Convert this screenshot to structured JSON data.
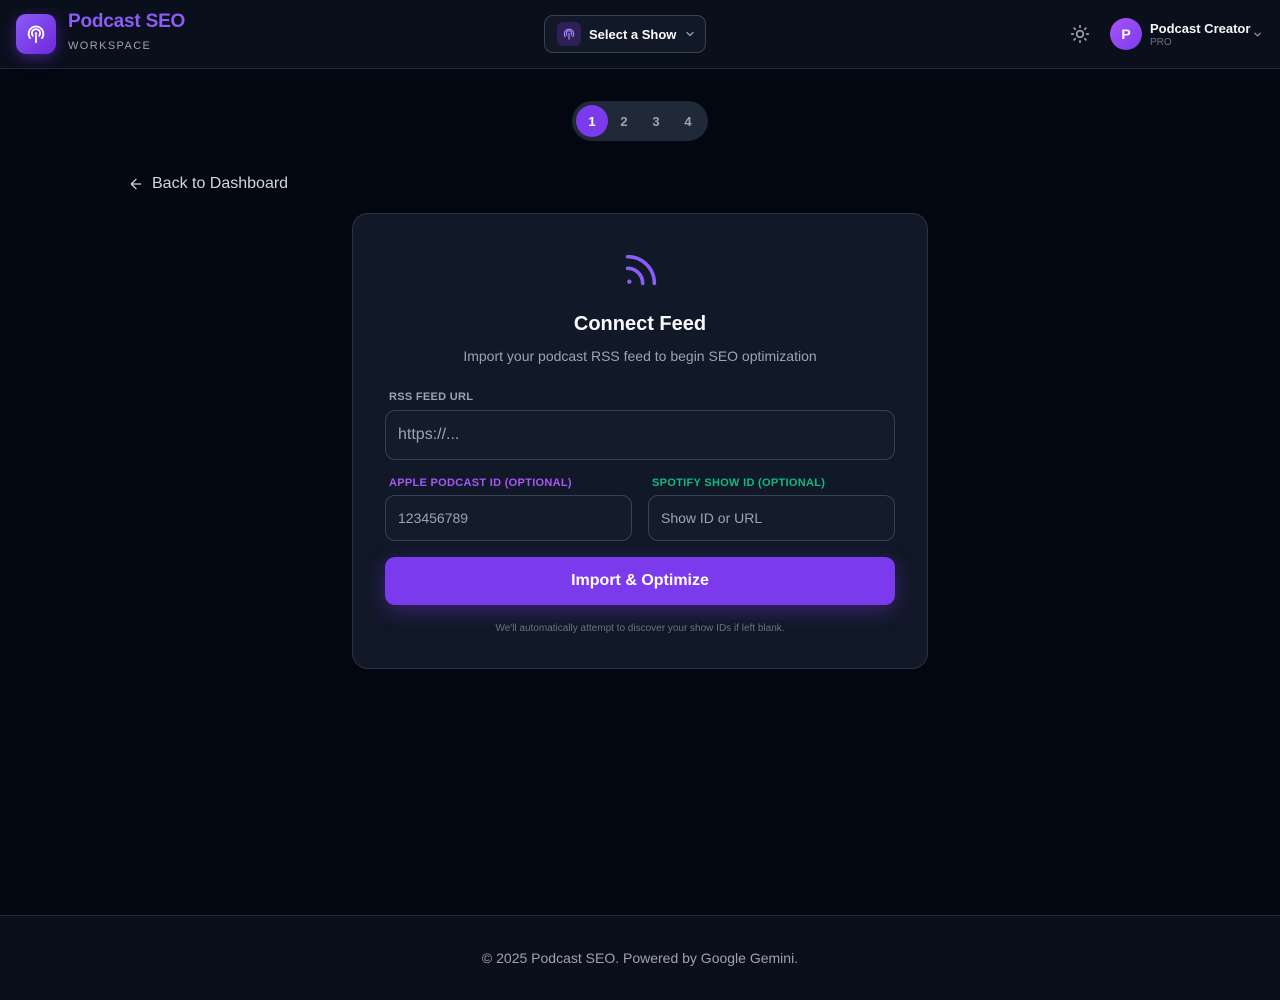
{
  "header": {
    "brand_title": "Podcast SEO",
    "brand_subtitle": "WORKSPACE",
    "show_selector_label": "Select a Show",
    "user": {
      "avatar_initial": "P",
      "name": "Podcast Creator",
      "plan": "PRO"
    }
  },
  "stepper": {
    "steps": [
      "1",
      "2",
      "3",
      "4"
    ],
    "active_step": 1
  },
  "back_link": "Back to Dashboard",
  "card": {
    "title": "Connect Feed",
    "subtitle": "Import your podcast RSS feed to begin SEO optimization",
    "rss": {
      "label": "RSS FEED URL",
      "placeholder": "https://...",
      "value": ""
    },
    "apple": {
      "label": "APPLE PODCAST ID (OPTIONAL)",
      "placeholder": "123456789",
      "value": ""
    },
    "spotify": {
      "label": "SPOTIFY SHOW ID (OPTIONAL)",
      "placeholder": "Show ID or URL",
      "value": ""
    },
    "submit_label": "Import & Optimize",
    "hint": "We'll automatically attempt to discover your show IDs if left blank."
  },
  "footer": {
    "text": "© 2025 Podcast SEO. Powered by Google Gemini."
  },
  "colors": {
    "accent": "#7c3aed",
    "apple_label": "#a855f7",
    "spotify_label": "#10b981",
    "background": "#030712"
  },
  "icons": {
    "logo": "podcast-icon",
    "theme": "sun-icon",
    "feed": "rss-icon",
    "back": "arrow-left-icon"
  }
}
